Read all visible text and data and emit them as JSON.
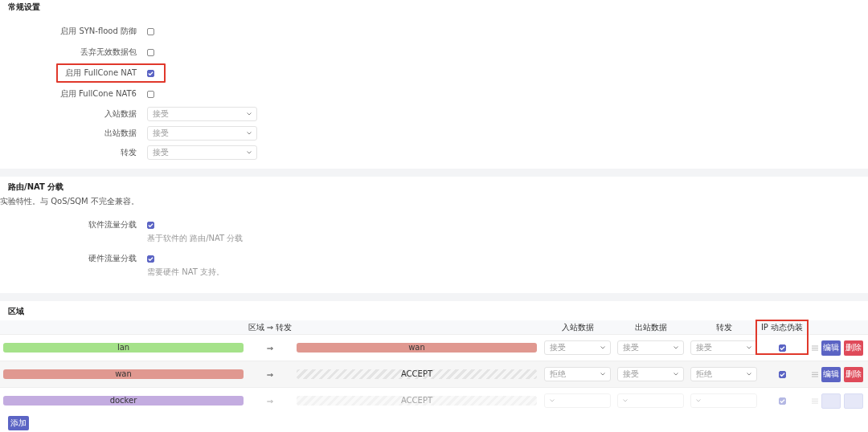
{
  "general": {
    "title": "常规设置",
    "options": [
      {
        "kind": "checkbox",
        "label": "启用 SYN-flood 防御",
        "checked": false,
        "highlighted": false
      },
      {
        "kind": "checkbox",
        "label": "丢弃无效数据包",
        "checked": false,
        "highlighted": false
      },
      {
        "kind": "checkbox",
        "label": "启用 FullCone NAT",
        "checked": true,
        "highlighted": true
      },
      {
        "kind": "checkbox",
        "label": "启用 FullCone NAT6",
        "checked": false,
        "highlighted": false
      },
      {
        "kind": "select",
        "label": "入站数据",
        "value": "接受"
      },
      {
        "kind": "select",
        "label": "出站数据",
        "value": "接受"
      },
      {
        "kind": "select",
        "label": "转发",
        "value": "接受"
      }
    ]
  },
  "offload": {
    "title": "路由/NAT 分载",
    "note": "实验特性。与 QoS/SQM 不完全兼容。",
    "options": [
      {
        "label": "软件流量分载",
        "checked": true,
        "description": "基于软件的 路由/NAT 分载"
      },
      {
        "label": "硬件流量分载",
        "checked": true,
        "description": "需要硬件 NAT 支持。"
      }
    ]
  },
  "zones": {
    "title": "区域",
    "columns": [
      {
        "label": "区域 ⇒ 转发",
        "highlighted": false
      },
      {
        "label": "入站数据",
        "highlighted": false
      },
      {
        "label": "出站数据",
        "highlighted": false
      },
      {
        "label": "转发",
        "highlighted": false
      },
      {
        "label": "IP 动态伪装",
        "highlighted": true
      }
    ],
    "rows": [
      {
        "zone": {
          "label": "lan",
          "color": "#a5e28a"
        },
        "arrow": "⇒",
        "forward": {
          "kind": "zone",
          "label": "wan",
          "color": "#e09890"
        },
        "input": "接受",
        "output": "接受",
        "forward_policy": "接受",
        "masquerade": true,
        "faded": false,
        "buttons": [
          "编辑",
          "删除"
        ]
      },
      {
        "zone": {
          "label": "wan",
          "color": "#e09890"
        },
        "arrow": "⇒",
        "forward": {
          "kind": "policy",
          "label": "ACCEPT"
        },
        "input": "拒绝",
        "output": "接受",
        "forward_policy": "拒绝",
        "masquerade": true,
        "faded": false,
        "buttons": [
          "编辑",
          "删除"
        ]
      },
      {
        "zone": {
          "label": "docker",
          "color": "#c3ace0"
        },
        "arrow": "⇒",
        "forward": {
          "kind": "policy",
          "label": "ACCEPT"
        },
        "masquerade": true,
        "faded": true
      }
    ],
    "add_button": "添加"
  }
}
